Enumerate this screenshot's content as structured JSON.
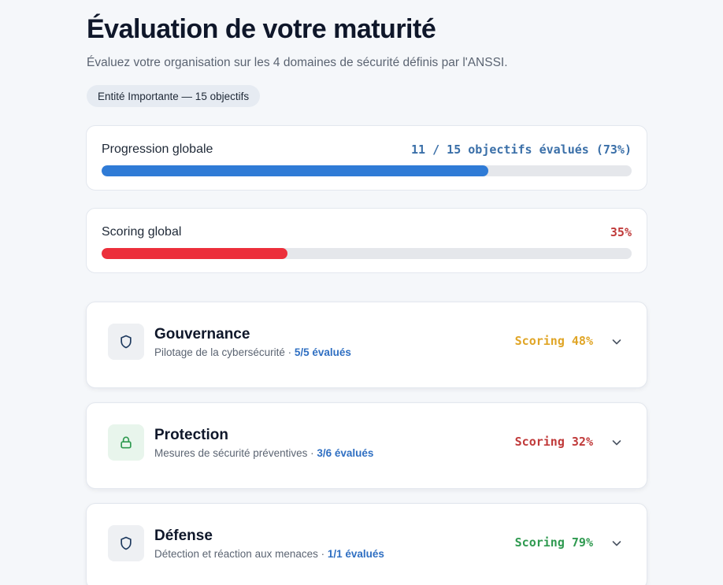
{
  "header": {
    "title": "Évaluation de votre maturité",
    "subtitle": "Évaluez votre organisation sur les 4 domaines de sécurité définis par l'ANSSI.",
    "entity_badge": "Entité Importante — 15 objectifs"
  },
  "progress": {
    "label": "Progression globale",
    "value_text": "11 / 15 objectifs évalués (73%)",
    "fraction": 0.73,
    "color": "#2f7bd6"
  },
  "scoring": {
    "label": "Scoring global",
    "value_text": "35%",
    "fraction": 0.35,
    "color": "#ec2f3b"
  },
  "domains": [
    {
      "name": "Gouvernance",
      "description": "Pilotage de la cybersécurité",
      "separator": " · ",
      "evaluated": "5/5 évalués",
      "score": "Scoring 48%",
      "score_color": "#e0a526",
      "icon": "shield-icon"
    },
    {
      "name": "Protection",
      "description": "Mesures de sécurité préventives",
      "separator": " · ",
      "evaluated": "3/6 évalués",
      "score": "Scoring 32%",
      "score_color": "#c03a3a",
      "icon": "lock-icon"
    },
    {
      "name": "Défense",
      "description": "Détection et réaction aux menaces",
      "separator": " · ",
      "evaluated": "1/1 évalués",
      "score": "Scoring 79%",
      "score_color": "#2f9a50",
      "icon": "shield-icon"
    }
  ]
}
